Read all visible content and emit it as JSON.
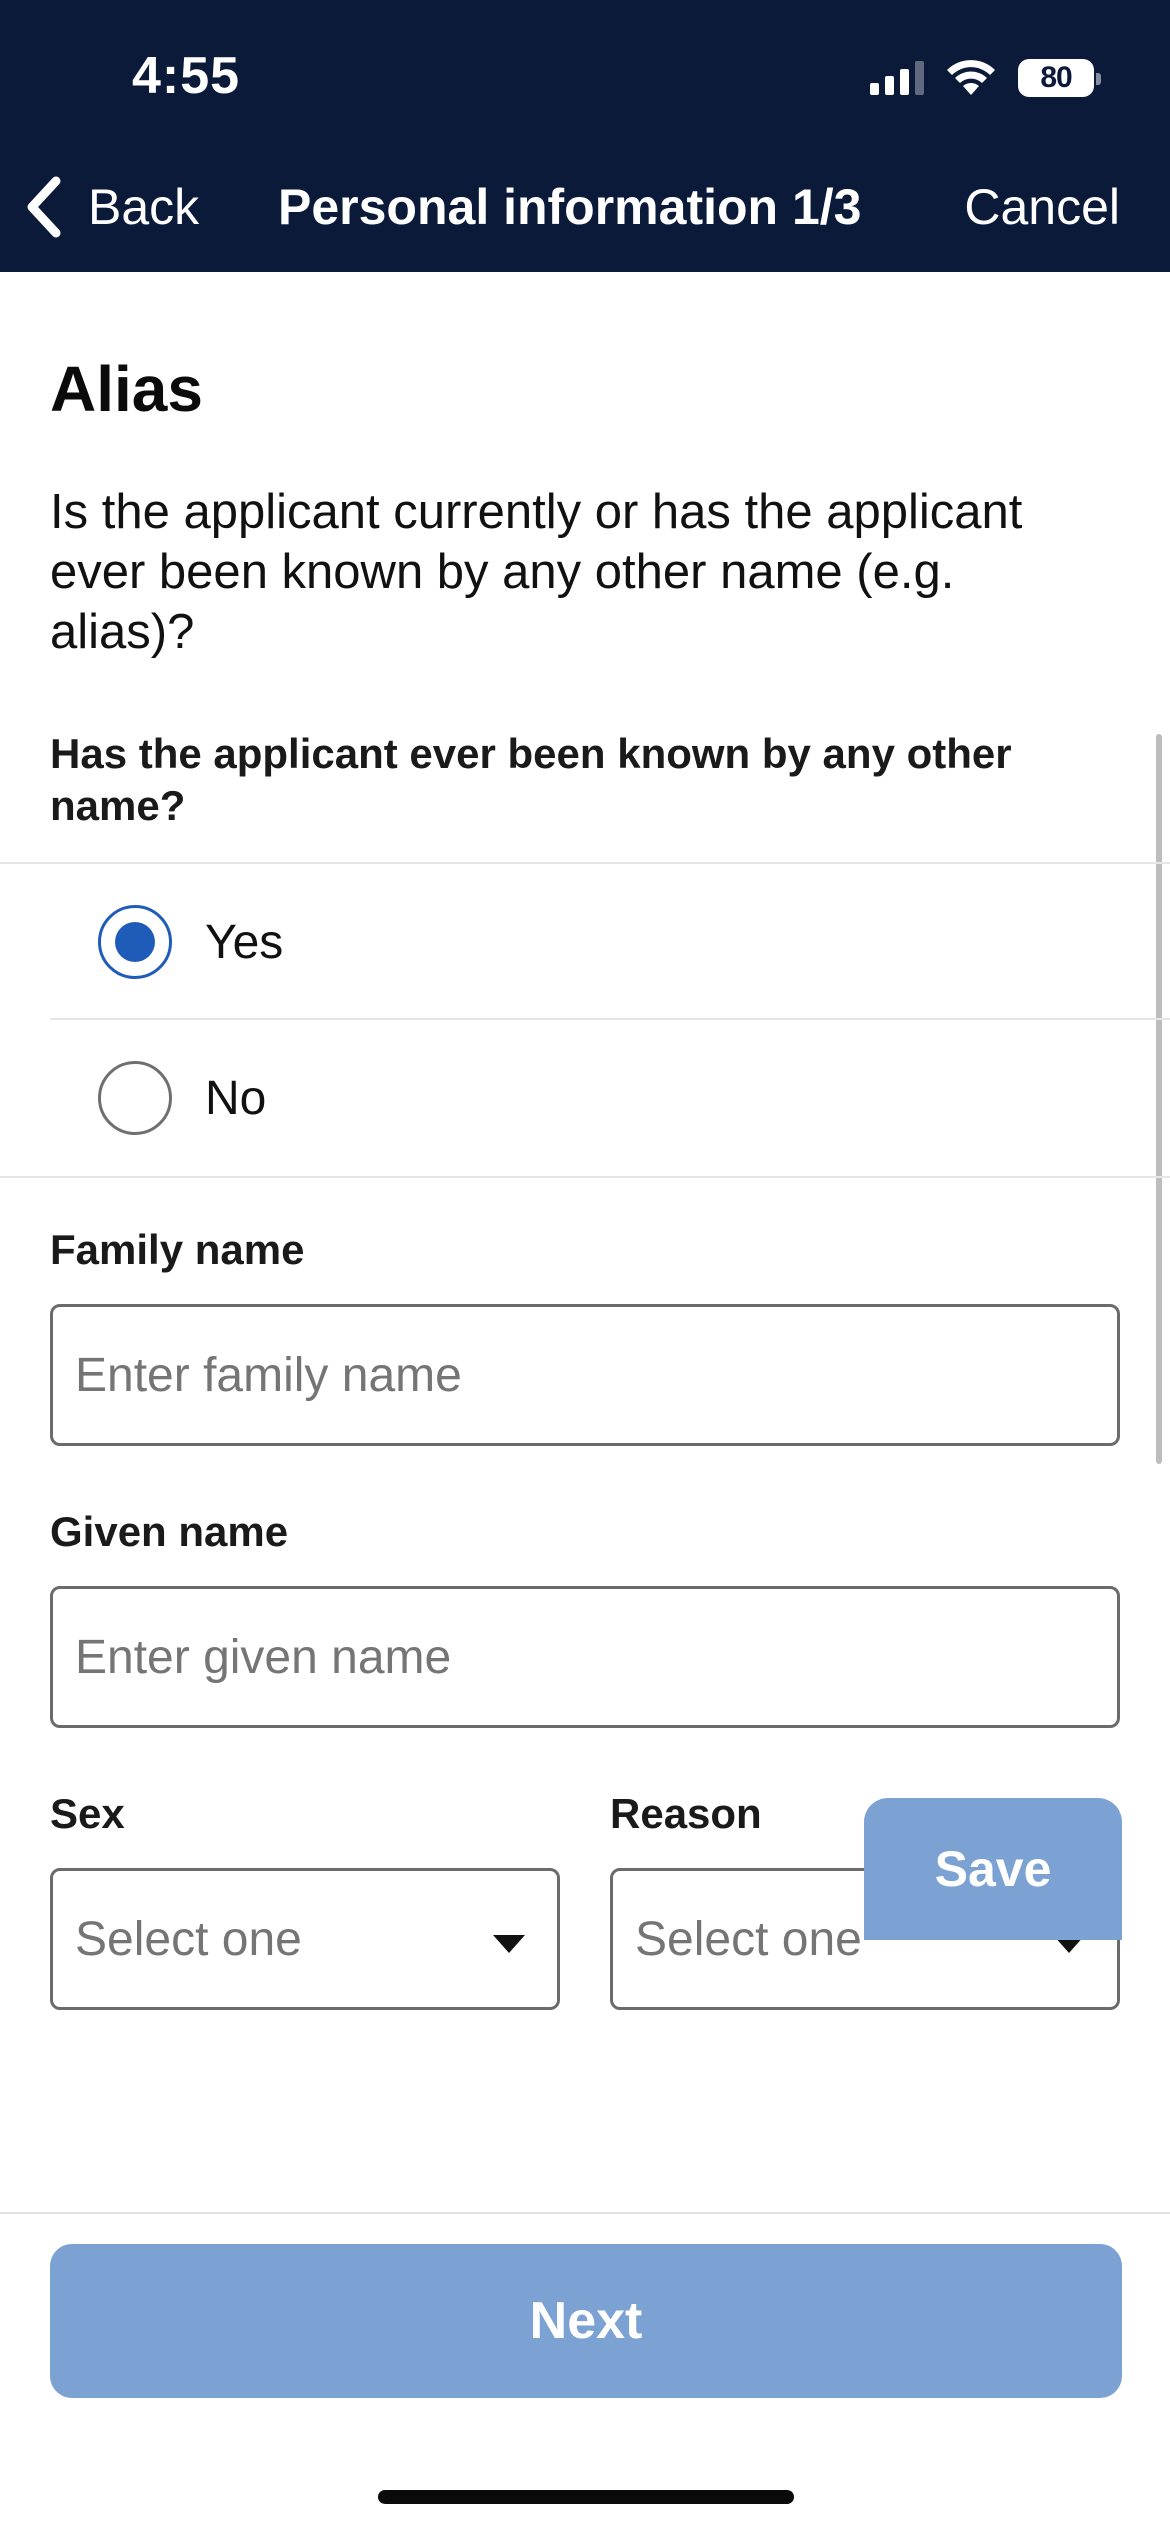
{
  "status_bar": {
    "time": "4:55",
    "battery_level": "80"
  },
  "nav": {
    "back_label": "Back",
    "title": "Personal information 1/3",
    "cancel_label": "Cancel"
  },
  "section": {
    "title": "Alias",
    "question": "Is the applicant currently or has the applicant ever been known by any other name (e.g. alias)?"
  },
  "alias_question": {
    "label": "Has the applicant ever been known by any other name?",
    "options": [
      {
        "label": "Yes",
        "selected": true
      },
      {
        "label": "No",
        "selected": false
      }
    ]
  },
  "family_name": {
    "label": "Family name",
    "placeholder": "Enter family name",
    "value": ""
  },
  "given_name": {
    "label": "Given name",
    "placeholder": "Enter given name",
    "value": ""
  },
  "sex": {
    "label": "Sex",
    "selected": "Select one"
  },
  "reason": {
    "label": "Reason",
    "selected": "Select one"
  },
  "actions": {
    "save_label": "Save",
    "next_label": "Next"
  },
  "colors": {
    "header_bg": "#0c1a3a",
    "accent": "#1f5bb8",
    "disabled_button": "#7ba2d3"
  }
}
